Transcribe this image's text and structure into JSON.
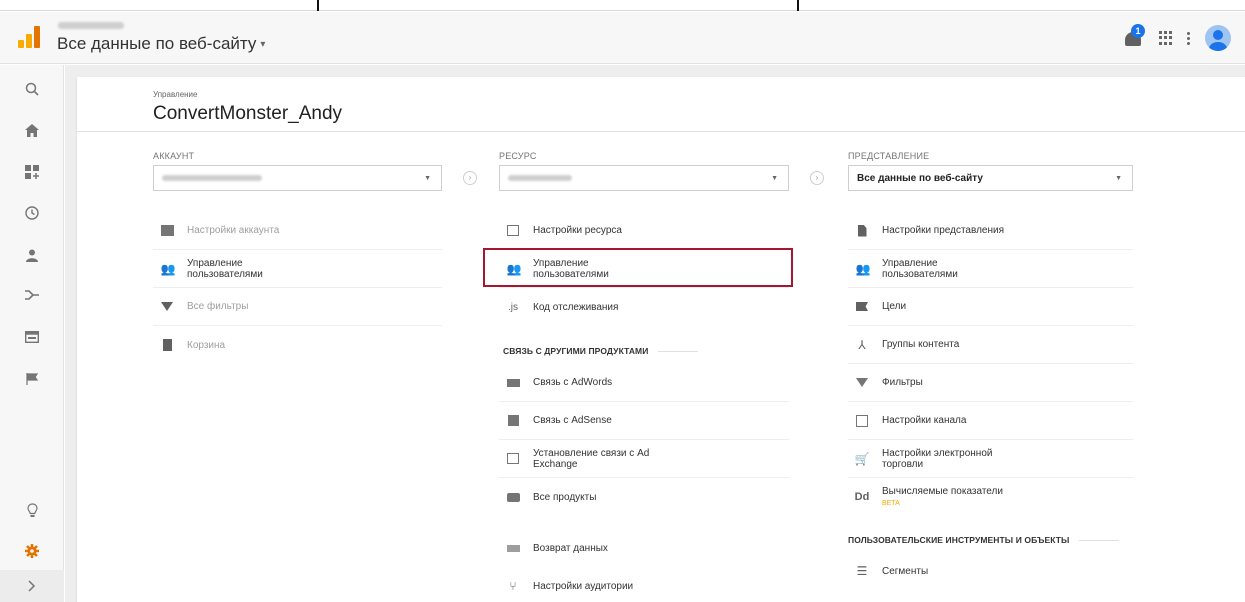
{
  "header": {
    "view_title": "Все данные по веб-сайту",
    "caret": "▾",
    "notification_count": "1"
  },
  "leftnav": {
    "items": [
      "search-icon",
      "home-icon",
      "dashboard-icon",
      "clock-icon",
      "person-icon",
      "acquisition-icon",
      "behavior-icon",
      "flag-icon",
      "lightbulb-icon",
      "admin-gear-icon",
      "expand-icon"
    ]
  },
  "admin": {
    "breadcrumb": "Управление",
    "account_name": "ConvertMonster_Andy"
  },
  "account": {
    "label": "АККАУНТ",
    "items": [
      "Настройки аккаунта",
      "Управление\nпользователями",
      "Все фильтры",
      "Корзина"
    ]
  },
  "property": {
    "label": "РЕСУРС",
    "items": [
      "Настройки ресурса",
      "Управление\nпользователями",
      "Код отслеживания"
    ],
    "section_linking": "СВЯЗЬ С ДРУГИМИ ПРОДУКТАМИ",
    "linking_items": [
      "Связь с AdWords",
      "Связь с AdSense",
      "Установление связи с Ad\nExchange",
      "Все продукты"
    ],
    "more_items": [
      "Возврат данных",
      "Настройки аудитории"
    ]
  },
  "view": {
    "label": "ПРЕДСТАВЛЕНИЕ",
    "selected": "Все данные по веб-сайту",
    "items": [
      "Настройки представления",
      "Управление\nпользователями",
      "Цели",
      "Группы контента",
      "Фильтры",
      "Настройки канала",
      "Настройки электронной\nторговли",
      "Вычисляемые показатели"
    ],
    "beta": "BETA",
    "section_tools": "ПОЛЬЗОВАТЕЛЬСКИЕ ИНСТРУМЕНТЫ И ОБЪЕКТЫ",
    "tools_items": [
      "Сегменты"
    ]
  },
  "icons": {
    "js": ".js",
    "dd": "Dd"
  },
  "colors": {
    "highlight": "#a3182f",
    "brand_orange": "#e37400",
    "accent_blue": "#1a73e8",
    "beta": "#f9ab00"
  }
}
